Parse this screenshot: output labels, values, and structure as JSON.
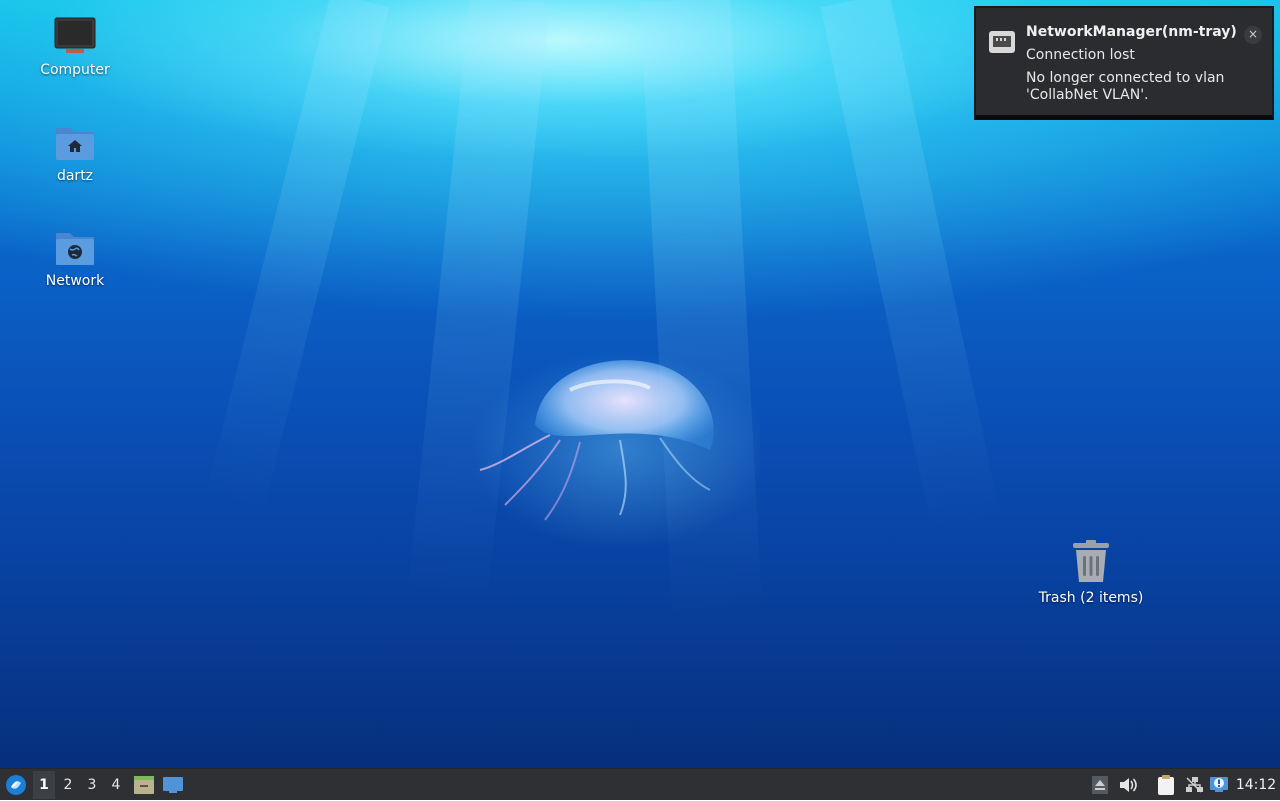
{
  "desktop": {
    "icons": [
      {
        "label": "Computer",
        "icon": "computer-monitor-icon"
      },
      {
        "label": "dartz",
        "icon": "home-folder-icon"
      },
      {
        "label": "Network",
        "icon": "network-folder-icon"
      },
      {
        "label": "Trash (2 items)",
        "icon": "trash-icon"
      }
    ]
  },
  "notification": {
    "app": "NetworkManager(nm-tray)",
    "summary": "Connection lost",
    "body": "No longer connected to vlan 'CollabNet VLAN'.",
    "close_glyph": "×",
    "icon": "ethernet-icon"
  },
  "taskbar": {
    "start_icon": "lubuntu-logo-icon",
    "workspaces": [
      "1",
      "2",
      "3",
      "4"
    ],
    "active_workspace": "1",
    "quicklaunch": [
      "file-manager-icon",
      "show-desktop-icon"
    ],
    "tray": [
      "eject-icon",
      "volume-icon",
      "clipboard-icon",
      "network-icon",
      "update-notifier-icon"
    ],
    "clock": "14:12"
  },
  "colors": {
    "panel": "#2e3034",
    "notification_bg": "#2b2c2f",
    "folder_blue": "#5b9be0"
  }
}
